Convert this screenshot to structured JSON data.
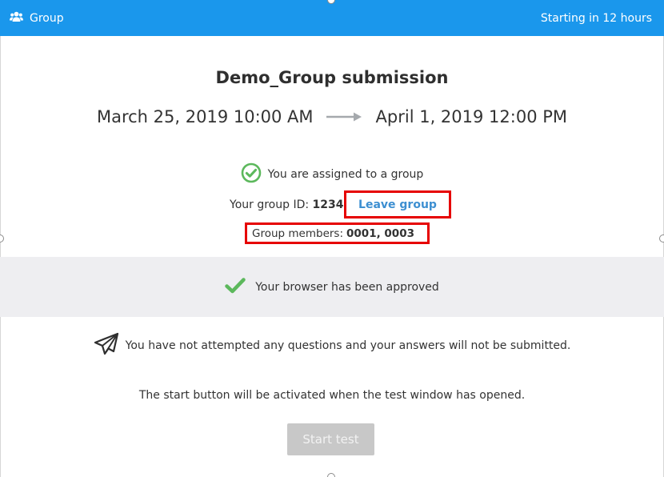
{
  "topbar": {
    "group_label": "Group",
    "status": "Starting in 12 hours",
    "background": "#1a97ec"
  },
  "test": {
    "title": "Demo_Group submission",
    "start": "March 25, 2019 10:00 AM",
    "end": "April 1, 2019 12:00 PM"
  },
  "group": {
    "assigned_text": "You are assigned to a group",
    "id_label": "Your group ID:",
    "id_value": "1234",
    "leave_label": "Leave group",
    "members_label": "Group members:",
    "members_value": "0001, 0003"
  },
  "browser": {
    "approved_text": "Your browser has been approved"
  },
  "notice": {
    "warning_text": "You have not attempted any questions and your answers will not be submitted.",
    "hint_text": "The start button will be activated when the test window has opened.",
    "start_label": "Start test"
  },
  "icons": [
    "group-icon",
    "arrow-right-icon",
    "check-circle-icon",
    "checkmark-icon",
    "paper-plane-icon"
  ],
  "colors": {
    "accent": "#1a97ec",
    "success": "#5cb85c",
    "link": "#3d8fd1",
    "highlight": "#e60000",
    "disabled": "#c8c8c8"
  }
}
